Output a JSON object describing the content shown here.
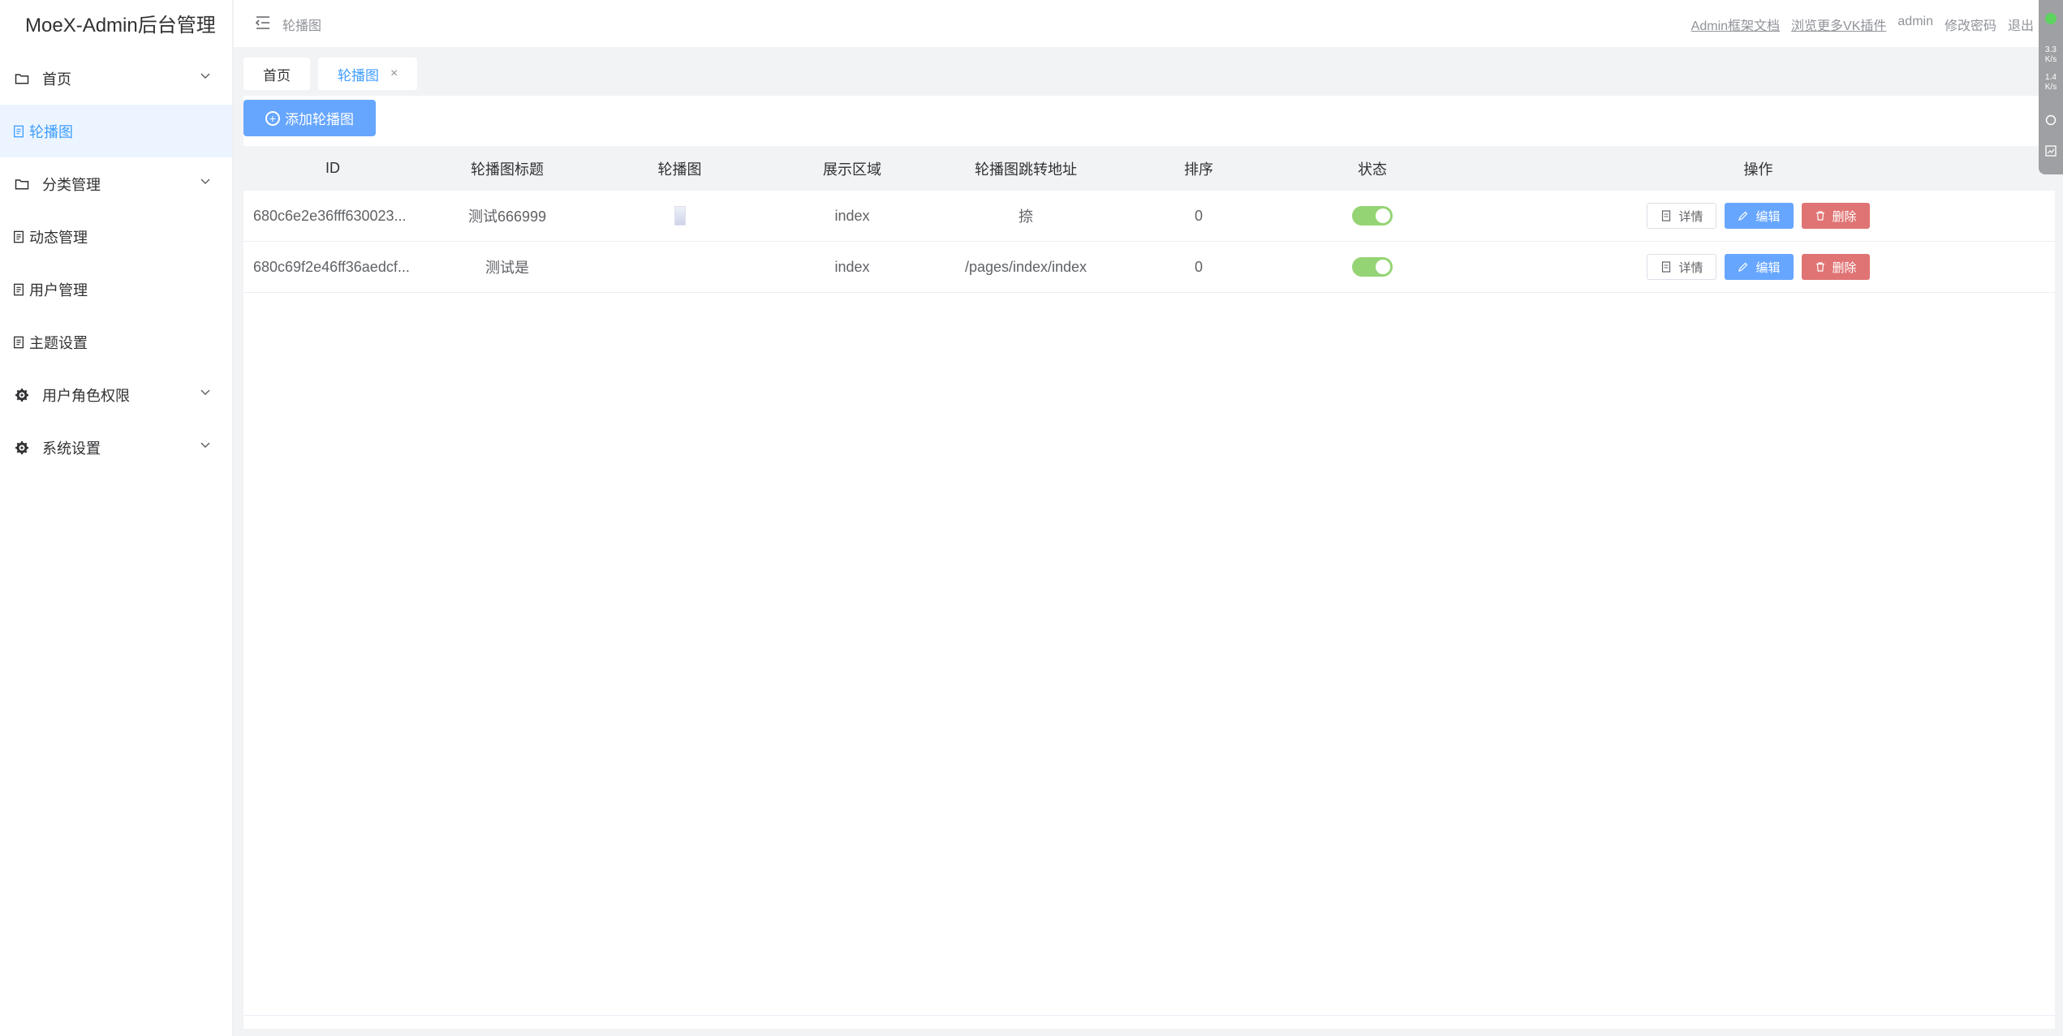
{
  "app": {
    "title": "MoeX-Admin后台管理"
  },
  "sidebar": {
    "items": [
      {
        "label": "首页",
        "icon": "folder-icon",
        "has_children": true
      },
      {
        "label": "轮播图",
        "icon": "document-icon",
        "active": true
      },
      {
        "label": "分类管理",
        "icon": "folder-icon",
        "has_children": true
      },
      {
        "label": "动态管理",
        "icon": "document-icon"
      },
      {
        "label": "用户管理",
        "icon": "document-icon"
      },
      {
        "label": "主题设置",
        "icon": "document-icon"
      },
      {
        "label": "用户角色权限",
        "icon": "gear-icon",
        "has_children": true
      },
      {
        "label": "系统设置",
        "icon": "gear-icon",
        "has_children": true
      }
    ]
  },
  "header": {
    "breadcrumb": "轮播图",
    "links": {
      "docs": "Admin框架文档",
      "plugins": "浏览更多VK插件",
      "user": "admin",
      "change_password": "修改密码",
      "logout": "退出"
    }
  },
  "tabs": [
    {
      "label": "首页"
    },
    {
      "label": "轮播图",
      "active": true,
      "close": "×"
    }
  ],
  "toolbar": {
    "add_label": "添加轮播图"
  },
  "table": {
    "columns": [
      "ID",
      "轮播图标题",
      "轮播图",
      "展示区域",
      "轮播图跳转地址",
      "排序",
      "状态",
      "操作"
    ],
    "rows": [
      {
        "id": "680c6e2e36fff630023...",
        "title": "测试666999",
        "area": "index",
        "url": "捺",
        "sort": "0",
        "status_on": true
      },
      {
        "id": "680c69f2e46ff36aedcf...",
        "title": "测试是",
        "area": "index",
        "url": "/pages/index/index",
        "sort": "0",
        "status_on": true
      }
    ],
    "actions": {
      "detail": "详情",
      "edit": "编辑",
      "delete": "删除"
    }
  },
  "widget": {
    "up": "3.3",
    "up_unit": "K/s",
    "down": "1.4",
    "down_unit": "K/s"
  },
  "colors": {
    "primary": "#409eff",
    "button_blue": "#66a6ff",
    "danger": "#e07474",
    "switch_on": "#95d475"
  }
}
